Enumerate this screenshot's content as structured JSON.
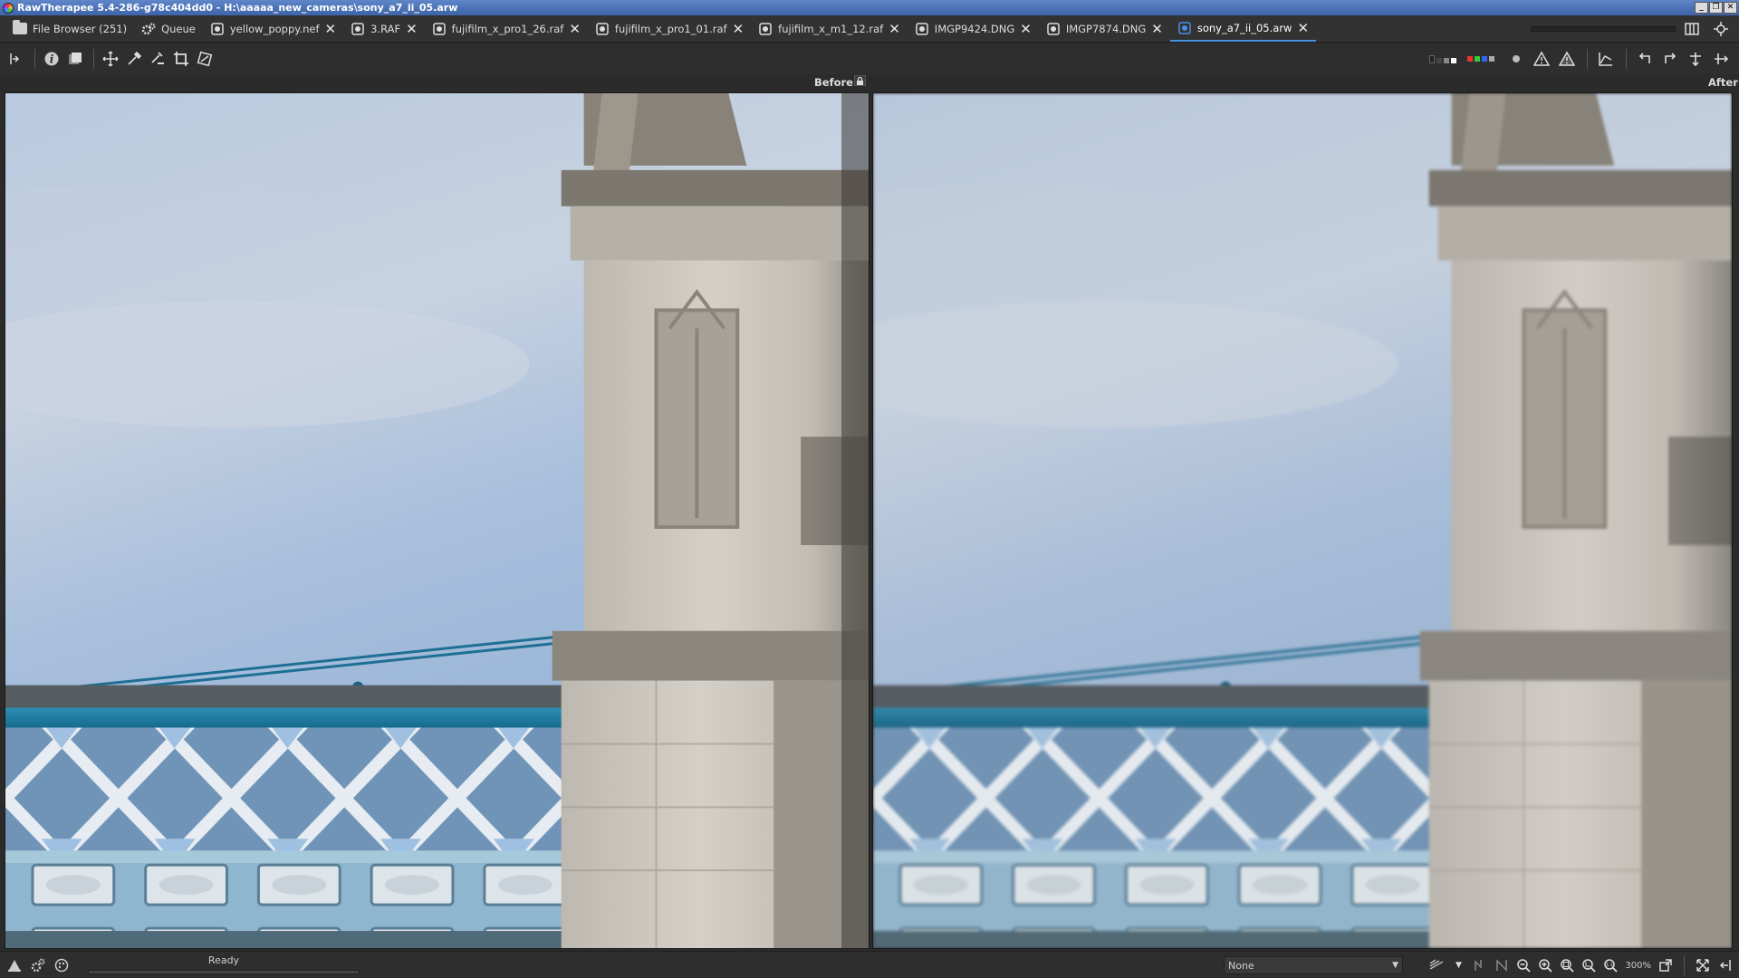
{
  "window": {
    "title": "RawTherapee 5.4-286-g78c404dd0 - H:\\aaaaa_new_cameras\\sony_a7_ii_05.arw",
    "controls": [
      "_",
      "❐",
      "✕"
    ]
  },
  "tabs": [
    {
      "label": "File Browser (251)",
      "icon": "folder-icon",
      "closable": false
    },
    {
      "label": "Queue",
      "icon": "gears-icon",
      "closable": false
    },
    {
      "label": "yellow_poppy.nef",
      "icon": "image-icon",
      "closable": true
    },
    {
      "label": "3.RAF",
      "icon": "image-icon",
      "closable": true
    },
    {
      "label": "fujifilm_x_pro1_26.raf",
      "icon": "image-icon",
      "closable": true
    },
    {
      "label": "fujifilm_x_pro1_01.raf",
      "icon": "image-icon",
      "closable": true
    },
    {
      "label": "fujifilm_x_m1_12.raf",
      "icon": "image-icon",
      "closable": true
    },
    {
      "label": "IMGP9424.DNG",
      "icon": "image-icon",
      "closable": true
    },
    {
      "label": "IMGP7874.DNG",
      "icon": "image-icon",
      "closable": true
    },
    {
      "label": "sony_a7_ii_05.arw",
      "icon": "image-icon",
      "closable": true,
      "active": true
    }
  ],
  "close_glyph": "✕",
  "preview": {
    "before_label": "Before",
    "after_label": "After"
  },
  "status": {
    "text": "Ready",
    "profile_select": "None",
    "zoom": "300%"
  },
  "colors": {
    "accent": "#4a90e2",
    "background": "#2b2b2b",
    "titlebar": "#4a72b8"
  }
}
